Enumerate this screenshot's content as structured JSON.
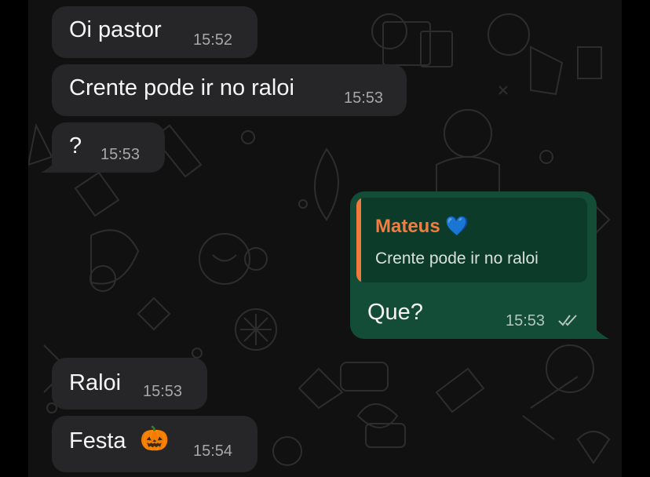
{
  "conversation": {
    "messages": [
      {
        "direction": "incoming",
        "text": "Oi pastor",
        "time": "15:52"
      },
      {
        "direction": "incoming",
        "text": "Crente pode ir no raloi",
        "time": "15:53"
      },
      {
        "direction": "incoming",
        "text": "?",
        "time": "15:53"
      },
      {
        "direction": "outgoing",
        "reply": {
          "author": "Mateus",
          "author_emoji": "💙",
          "text": "Crente pode ir no raloi"
        },
        "text": "Que?",
        "time": "15:53",
        "status": "read"
      },
      {
        "direction": "incoming",
        "text": "Raloi",
        "time": "15:53"
      },
      {
        "direction": "incoming",
        "text": "Festa",
        "emoji": "🎃",
        "time": "15:54"
      }
    ]
  },
  "colors": {
    "background": "#111111",
    "incoming_bubble": "#262628",
    "outgoing_bubble": "#144d37",
    "quote_bar": "#f07a3c",
    "quote_author": "#f27d43",
    "read_ticks": "#b3c7bd"
  },
  "icons": {
    "heart": "blue-heart-emoji",
    "pumpkin": "jack-o-lantern-emoji",
    "status": "double-check-icon"
  }
}
